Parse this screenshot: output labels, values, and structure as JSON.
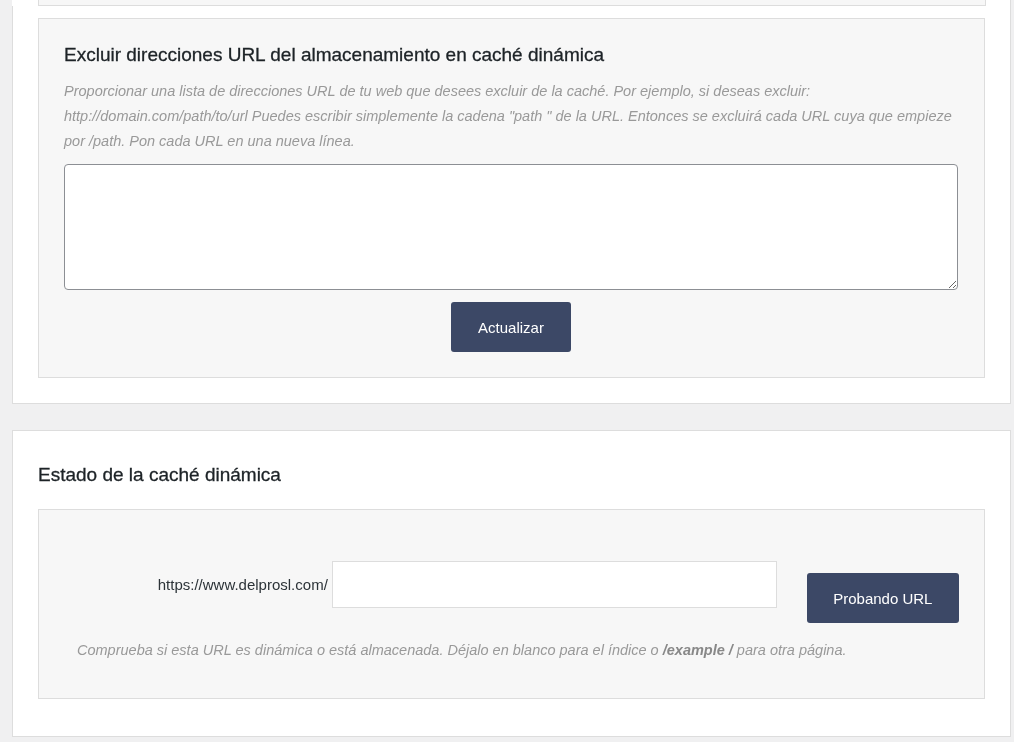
{
  "exclude_section": {
    "title": "Excluir direcciones URL del almacenamiento en caché dinámica",
    "description": "Proporcionar una lista de direcciones URL de tu web que desees excluir de la caché. Por ejemplo, si deseas excluir: http://domain.com/path/to/url Puedes escribir simplemente la cadena \"path \" de la URL. Entonces se excluirá cada URL cuya que empieze por /path. Pon cada URL en una nueva línea.",
    "button": "Actualizar"
  },
  "status_section": {
    "title": "Estado de la caché dinámica",
    "url_prefix": "https://www.delprosl.com/",
    "button": "Probando URL",
    "note": "Comprueba si esta URL es dinámica o está almacenada. Déjalo en blanco para el índice o **/example /** para otra página."
  }
}
